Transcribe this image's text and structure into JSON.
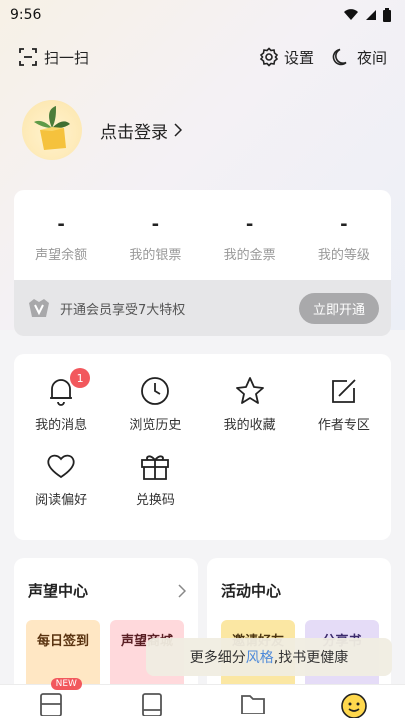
{
  "status_bar": {
    "time": "9:56"
  },
  "top_bar": {
    "scan_label": "扫一扫",
    "settings_label": "设置",
    "night_label": "夜间"
  },
  "profile": {
    "login_label": "点击登录"
  },
  "stats": [
    {
      "value": "-",
      "label": "声望余额"
    },
    {
      "value": "-",
      "label": "我的银票"
    },
    {
      "value": "-",
      "label": "我的金票"
    },
    {
      "value": "-",
      "label": "我的等级"
    }
  ],
  "vip": {
    "text": "开通会员享受7大特权",
    "button": "立即开通"
  },
  "menu": [
    {
      "label": "我的消息",
      "icon": "bell-icon",
      "badge": "1"
    },
    {
      "label": "浏览历史",
      "icon": "clock-icon"
    },
    {
      "label": "我的收藏",
      "icon": "star-icon"
    },
    {
      "label": "作者专区",
      "icon": "edit-icon"
    },
    {
      "label": "阅读偏好",
      "icon": "heart-icon"
    },
    {
      "label": "兑换码",
      "icon": "gift-icon"
    }
  ],
  "sections": {
    "reputation": {
      "title": "声望中心",
      "promo1": "每日签到",
      "promo2": "声望商城"
    },
    "activity": {
      "title": "活动中心",
      "promo1": "邀请好友",
      "promo2": "分享书"
    }
  },
  "toast": {
    "prefix": "更多细分",
    "highlight": "风格",
    "suffix": ",找书更健康"
  },
  "tab_bar": {
    "new_badge": "NEW"
  },
  "colors": {
    "accent_red": "#f2585d",
    "highlight_blue": "#4f8ad9"
  }
}
